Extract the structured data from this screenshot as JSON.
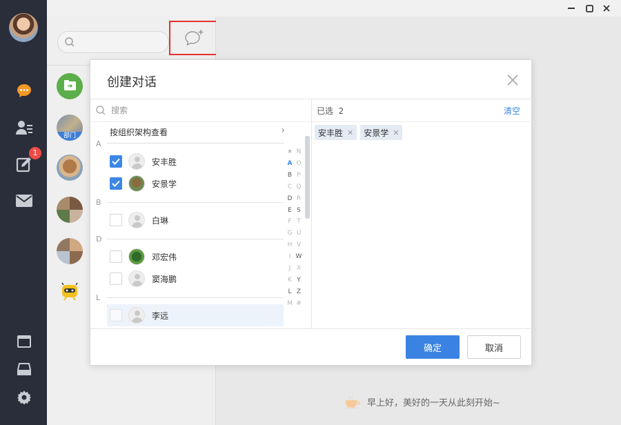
{
  "sidebar": {
    "unread_badge": "1",
    "icons": [
      "chat-icon",
      "contacts-icon",
      "notes-icon",
      "mail-icon",
      "window-icon",
      "drive-icon",
      "settings-icon"
    ]
  },
  "session_list": {
    "search_placeholder": "",
    "dept_label": "部门"
  },
  "main": {
    "greeting": "早上好，美好的一天从此刻开始~"
  },
  "dialog": {
    "title": "创建对话",
    "search_placeholder": "搜索",
    "org_link": "按组织架构查看",
    "groups": [
      {
        "letter": "A",
        "contacts": [
          {
            "name": "安丰胜",
            "checked": true
          },
          {
            "name": "安景学",
            "checked": true
          }
        ]
      },
      {
        "letter": "B",
        "contacts": [
          {
            "name": "白琳",
            "checked": false
          }
        ]
      },
      {
        "letter": "D",
        "contacts": [
          {
            "name": "邓宏伟",
            "checked": false
          },
          {
            "name": "窦海鹏",
            "checked": false
          }
        ]
      },
      {
        "letter": "L",
        "contacts": [
          {
            "name": "李远",
            "checked": false
          }
        ]
      }
    ],
    "index_left": [
      "★",
      "A",
      "B",
      "C",
      "D",
      "E",
      "F",
      "G",
      "H",
      "I",
      "J",
      "K",
      "L",
      "M"
    ],
    "index_right": [
      "N",
      "O",
      "P",
      "Q",
      "R",
      "S",
      "T",
      "U",
      "V",
      "W",
      "X",
      "Y",
      "Z",
      "#"
    ],
    "selected_label": "已选",
    "selected_count": "2",
    "clear_label": "清空",
    "selected": [
      "安丰胜",
      "安景学"
    ],
    "ok_label": "确定",
    "cancel_label": "取消"
  },
  "colors": {
    "accent": "#3d87e5",
    "nav_bg": "#2a2e3a",
    "badge": "#ee4b45",
    "highlight_box": "#e6312b",
    "nav_active": "#f39a26"
  }
}
